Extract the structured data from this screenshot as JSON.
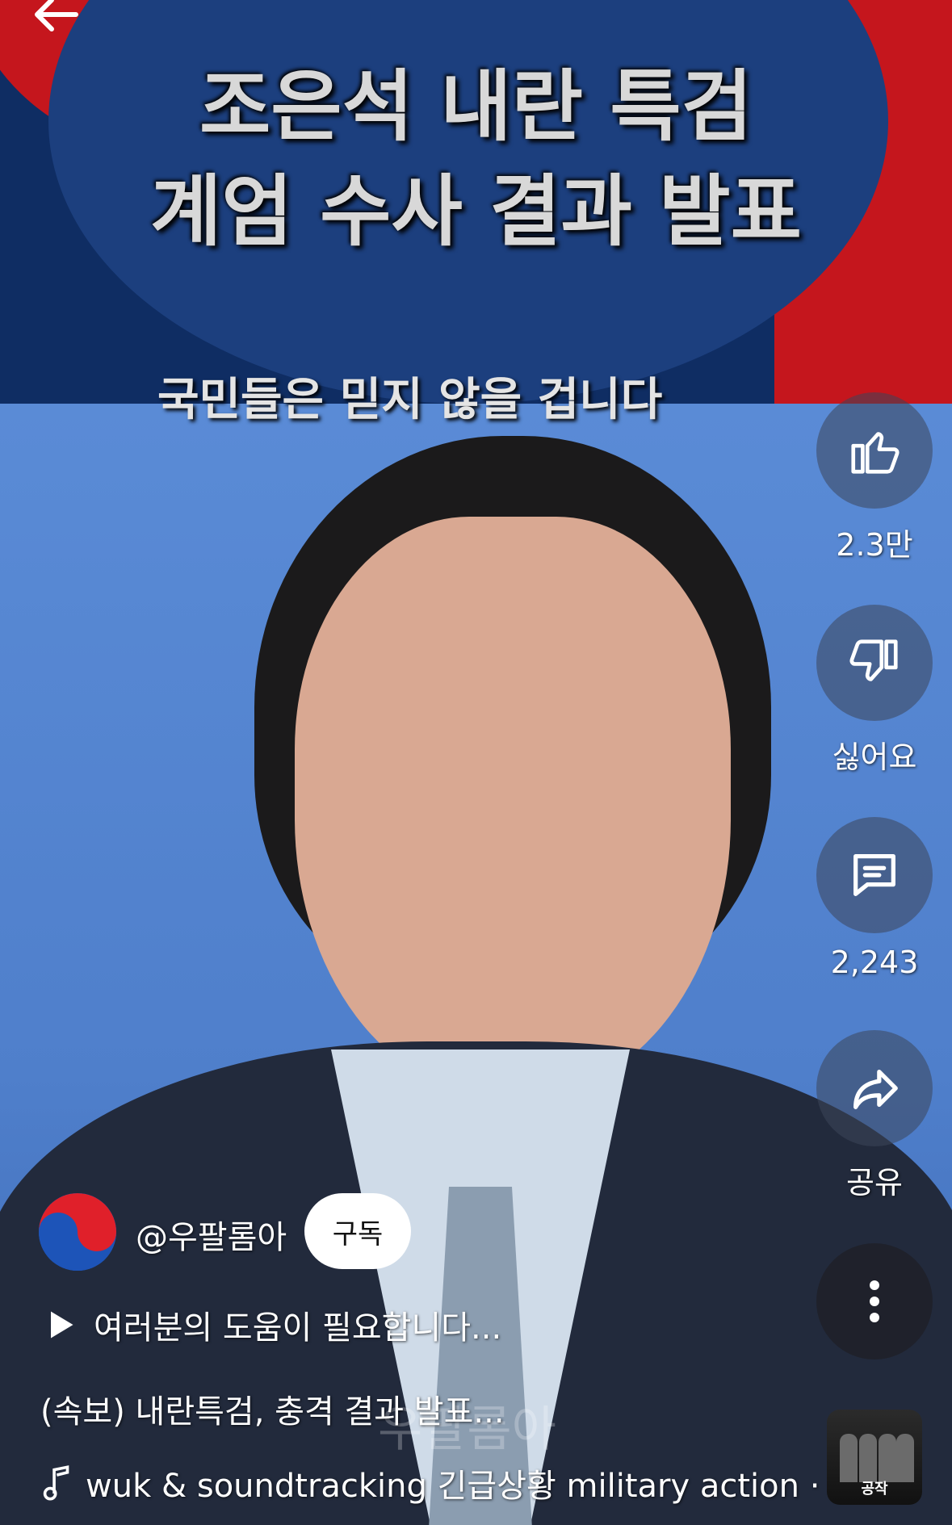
{
  "video": {
    "title_line1": "조은석 내란 특검",
    "title_line2": "계엄 수사 결과 발표",
    "subtitle": "국민들은 믿지 않을 겁니다",
    "watermark": "우팔롬아"
  },
  "actions": {
    "like_count": "2.3만",
    "dislike_label": "싫어요",
    "comment_count": "2,243",
    "share_label": "공유"
  },
  "channel": {
    "handle": "@우팔롬아",
    "subscribe_label": "구독"
  },
  "description": {
    "help_text": "여러분의 도움이 필요합니다...",
    "caption": "(속보) 내란특검, 충격 결과 발표..."
  },
  "music": {
    "text": "wuk & soundtracking     긴급상황 military action ·",
    "thumbnail_title": "공작"
  },
  "colors": {
    "flag_red": "#c5161d",
    "flag_blue": "#1c3f7e",
    "background_blue": "#5a8bd6"
  }
}
